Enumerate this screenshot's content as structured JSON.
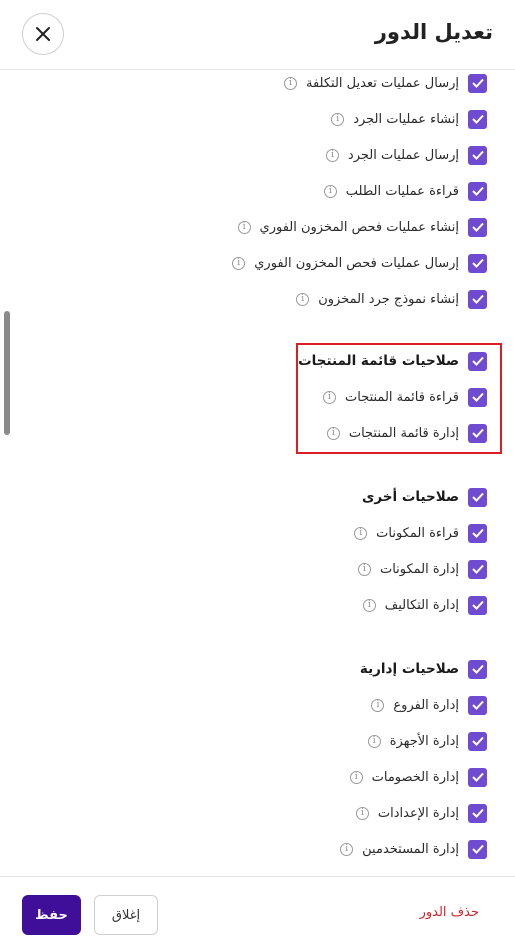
{
  "header": {
    "title": "تعديل الدور"
  },
  "footer": {
    "save_label": "حفظ",
    "close_label": "إغلاق",
    "delete_label": "حذف الدور"
  },
  "permissions": {
    "inventory_items": [
      {
        "label": "إرسال عمليات تعديل التكلفة",
        "checked": true
      },
      {
        "label": "إنشاء عمليات الجرد",
        "checked": true
      },
      {
        "label": "إرسال عمليات الجرد",
        "checked": true
      },
      {
        "label": "قراءة عمليات الطلب",
        "checked": true
      },
      {
        "label": "إنشاء عمليات فحص المخزون الفوري",
        "checked": true
      },
      {
        "label": "إرسال عمليات فحص المخزون الفوري",
        "checked": true
      },
      {
        "label": "إنشاء نموذج جرد المخزون",
        "checked": true
      }
    ],
    "product_list": {
      "title": "صلاحيات قائمة المنتجات",
      "items": [
        {
          "label": "قراءة قائمة المنتجات",
          "checked": true
        },
        {
          "label": "إدارة قائمة المنتجات",
          "checked": true
        }
      ]
    },
    "other": {
      "title": "صلاحيات أخرى",
      "items": [
        {
          "label": "قراءة المكونات",
          "checked": true
        },
        {
          "label": "إدارة المكونات",
          "checked": true
        },
        {
          "label": "إدارة التكاليف",
          "checked": true
        }
      ]
    },
    "admin": {
      "title": "صلاحيات إدارية",
      "items": [
        {
          "label": "إدارة الفروع",
          "checked": true
        },
        {
          "label": "إدارة الأجهزة",
          "checked": true
        },
        {
          "label": "إدارة الخصومات",
          "checked": true
        },
        {
          "label": "إدارة الإعدادات",
          "checked": true
        },
        {
          "label": "إدارة المستخدمين",
          "checked": true
        }
      ]
    }
  },
  "icons": {
    "close": "close-icon",
    "check": "check-icon",
    "info": "info-icon"
  },
  "colors": {
    "checkbox": "#6f4bd1",
    "save_button": "#3f0f9a",
    "delete_text": "#d4232a",
    "highlight_border": "#dc1f26"
  }
}
